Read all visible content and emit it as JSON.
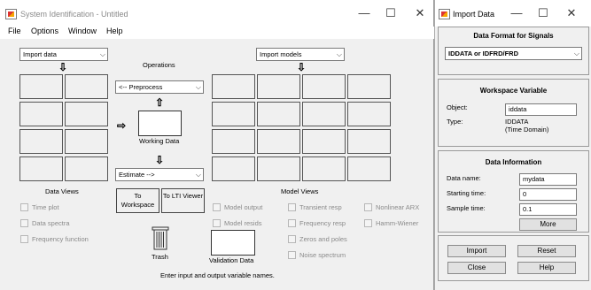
{
  "main_window": {
    "title": "System Identification - Untitled",
    "menu": [
      "File",
      "Options",
      "Window",
      "Help"
    ],
    "import_data_combo": "Import data",
    "import_models_combo": "Import models",
    "operations_label": "Operations",
    "preprocess_combo": "<-- Preprocess",
    "working_data_label": "Working Data",
    "estimate_combo": "Estimate -->",
    "data_views_label": "Data Views",
    "to_workspace_label": "To Workspace",
    "to_lti_viewer_label": "To LTI Viewer",
    "model_views_label": "Model Views",
    "trash_label": "Trash",
    "validation_data_label": "Validation Data",
    "status_text": "Enter input and output variable names.",
    "data_view_checkboxes": [
      "Time plot",
      "Data spectra",
      "Frequency function"
    ],
    "model_view_checkboxes": {
      "col1": [
        "Model output",
        "Model resids"
      ],
      "col2": [
        "Transient resp",
        "Frequency resp",
        "Zeros and poles",
        "Noise spectrum"
      ],
      "col3": [
        "Nonlinear ARX",
        "Hamm-Wiener"
      ]
    }
  },
  "import_dialog": {
    "title": "Import Data",
    "format_panel_title": "Data Format for Signals",
    "format_value": "IDDATA or IDFRD/FRD",
    "workspace_panel_title": "Workspace Variable",
    "object_label": "Object:",
    "object_value": "iddata",
    "type_label": "Type:",
    "type_value_line1": "IDDATA",
    "type_value_line2": "(Time Domain)",
    "info_panel_title": "Data Information",
    "data_name_label": "Data name:",
    "data_name_value": "mydata",
    "starting_time_label": "Starting time:",
    "starting_time_value": "0",
    "sample_time_label": "Sample time:",
    "sample_time_value": "0.1",
    "more_button": "More",
    "import_button": "Import",
    "reset_button": "Reset",
    "close_button": "Close",
    "help_button": "Help"
  }
}
